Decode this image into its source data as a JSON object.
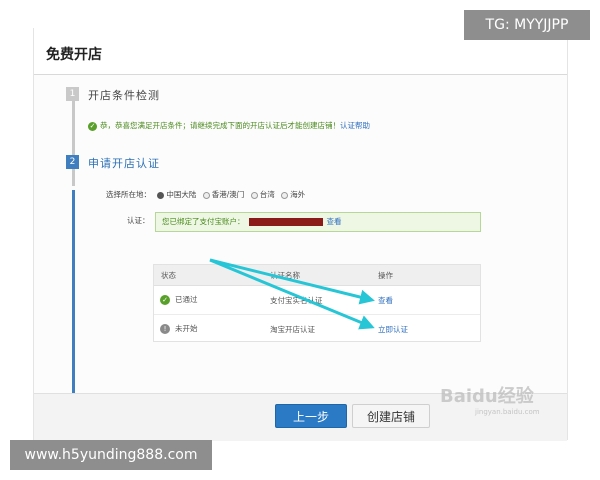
{
  "overlay": {
    "tg_badge": "TG: MYYJJPP",
    "url_badge": "www.h5yunding888.com"
  },
  "page": {
    "title": "免费开店"
  },
  "step1": {
    "number": "1",
    "label": "开店条件检测",
    "notice_text": "恭，恭喜您满足开店条件；请继续完成下面的开店认证后才能创建店铺！",
    "notice_link": "认证帮助"
  },
  "step2": {
    "number": "2",
    "label": "申请开店认证",
    "region_label": "选择所在地：",
    "regions": [
      "中国大陆",
      "香港/澳门",
      "台湾",
      "海外"
    ],
    "selected_region": "中国大陆",
    "cert_label": "认证：",
    "cert_text": "您已绑定了支付宝账户：",
    "cert_view_link": "查看"
  },
  "table": {
    "headers": [
      "状态",
      "认证名称",
      "操作"
    ],
    "rows": [
      {
        "status": "已通过",
        "name": "支付宝实名认证",
        "action": "查看",
        "status_icon": "check-icon"
      },
      {
        "status": "未开始",
        "name": "淘宝开店认证",
        "action": "立即认证",
        "status_icon": "info-icon"
      }
    ]
  },
  "buttons": {
    "prev": "上一步",
    "create": "创建店铺"
  },
  "watermark": {
    "text": "Baidu经验",
    "sub": "jingyan.baidu.com"
  },
  "colors": {
    "accent_blue": "#2a7ac6",
    "success_green": "#59a02a",
    "arrow_cyan": "#27c6d6",
    "redaction": "#8b1a1a"
  }
}
